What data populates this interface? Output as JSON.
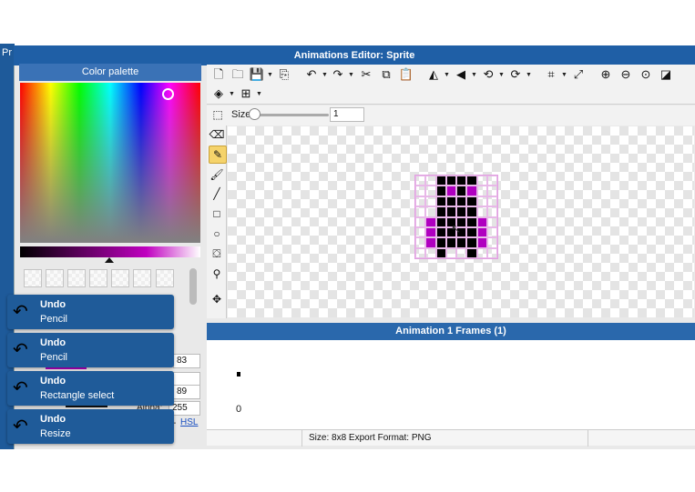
{
  "background_app": {
    "title_fragment": "Pr"
  },
  "window": {
    "title": "Animations Editor: Sprite"
  },
  "palette": {
    "header": "Color palette",
    "fields": {
      "g": "83",
      "b": "89",
      "alpha_label": "Alpha:",
      "alpha": "255",
      "hsl_link": "HSL"
    }
  },
  "toolbar": {
    "size_label": "Size",
    "size_value": "1"
  },
  "frames": {
    "header": "Animation 1 Frames (1)",
    "frame_index": "0"
  },
  "status": {
    "text": "Size: 8x8   Export Format: PNG"
  },
  "undo_history": [
    {
      "action": "Undo",
      "detail": "Pencil"
    },
    {
      "action": "Undo",
      "detail": "Pencil"
    },
    {
      "action": "Undo",
      "detail": "Rectangle select"
    },
    {
      "action": "Undo",
      "detail": "Resize"
    }
  ],
  "colors": {
    "accent": "#1f5fa6",
    "sprite_black": "#000000",
    "sprite_magenta": "#b000c0"
  },
  "sprite_pixels": [
    "..KKKK..",
    "..KMKM..",
    "..KKKK..",
    "..KKKK..",
    ".MKKKKM.",
    ".MKKKKM.",
    ".MKKKKM.",
    "..K..K.."
  ]
}
